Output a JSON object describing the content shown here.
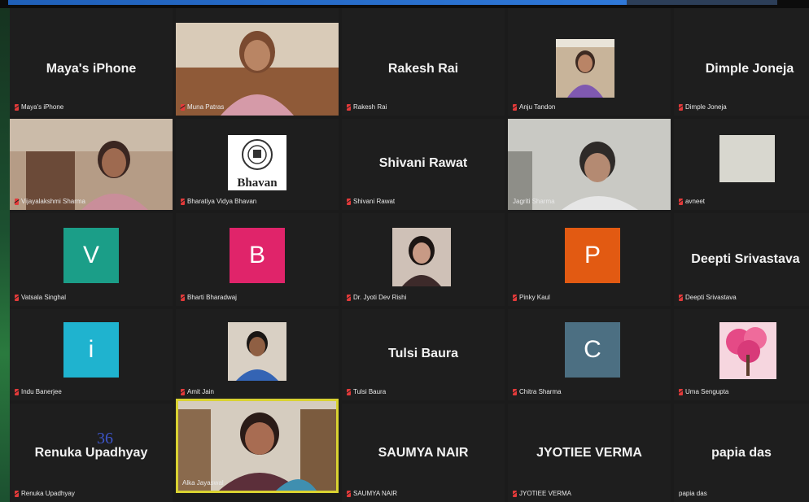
{
  "tiles": [
    {
      "big_name": "Maya's iPhone",
      "label": "Maya's iPhone"
    },
    {
      "label": "Muna Patras"
    },
    {
      "big_name": "Rakesh Rai",
      "label": "Rakesh Rai"
    },
    {
      "label": "Anju Tandon"
    },
    {
      "big_name": "Dimple Joneja",
      "label": "Dimple Joneja"
    },
    {
      "label": "Vijayalakshmi Sharma"
    },
    {
      "label": "Bharatiya Vidya Bhavan",
      "logo_text": "Bhavan"
    },
    {
      "big_name": "Shivani Rawat",
      "label": "Shivani Rawat"
    },
    {
      "label": "Jagriti Sharma"
    },
    {
      "label": "avneet"
    },
    {
      "initial": "V",
      "label": "Vatsala Singhal"
    },
    {
      "initial": "B",
      "label": "Bharti Bharadwaj"
    },
    {
      "label": "Dr. Jyoti Dev Rishi"
    },
    {
      "initial": "P",
      "label": "Pinky Kaul"
    },
    {
      "big_name": "Deepti Srivastava",
      "label": "Deepti Srivastava"
    },
    {
      "initial": "i",
      "label": "Indu Banerjee"
    },
    {
      "label": "Amit Jain"
    },
    {
      "big_name": "Tulsi Baura",
      "label": "Tulsi Baura"
    },
    {
      "initial": "C",
      "label": "Chitra Sharma"
    },
    {
      "label": "Uma Sengupta"
    },
    {
      "big_name": "Renuka Upadhyay",
      "label": "Renuka Upadhyay"
    },
    {
      "label": "Alka Jayaswal"
    },
    {
      "big_name": "SAUMYA NAIR",
      "label": "SAUMYA NAIR"
    },
    {
      "big_name": "JYOTIEE VERMA",
      "label": "JYOTIEE VERMA"
    },
    {
      "big_name": "papia das",
      "label": "papia das"
    }
  ],
  "overlay_number": "36",
  "colors": {
    "avatar_v": "#1b9e88",
    "avatar_b": "#e0246a",
    "avatar_p": "#e25a12",
    "avatar_i": "#1fb3cf",
    "avatar_c": "#4c6f82",
    "active_speaker": "#d9d231",
    "muted_mic": "#e23a3a"
  }
}
